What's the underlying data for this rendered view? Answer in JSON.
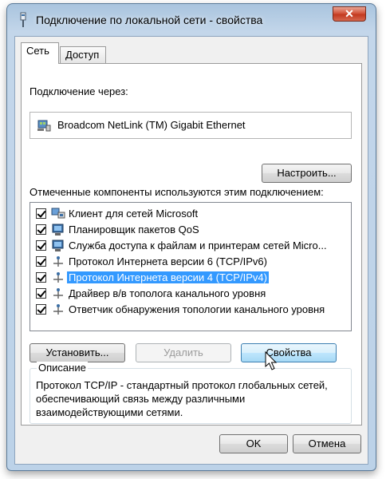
{
  "window": {
    "title": "Подключение по локальной сети - свойства",
    "close_glyph": "✕"
  },
  "tabs": [
    {
      "label": "Сеть",
      "active": true
    },
    {
      "label": "Доступ",
      "active": false
    }
  ],
  "connection": {
    "label": "Подключение через:",
    "adapter": "Broadcom NetLink (TM) Gigabit Ethernet",
    "adapter_icon": "network-adapter-icon",
    "configure_button": "Настроить..."
  },
  "components": {
    "label": "Отмеченные компоненты используются этим подключением:",
    "items": [
      {
        "label": "Клиент для сетей Microsoft",
        "checked": true,
        "icon": "network-client-icon",
        "selected": false
      },
      {
        "label": "Планировщик пакетов QoS",
        "checked": true,
        "icon": "network-service-icon",
        "selected": false
      },
      {
        "label": "Служба доступа к файлам и принтерам сетей Micro...",
        "checked": true,
        "icon": "network-service-icon",
        "selected": false
      },
      {
        "label": "Протокол Интернета версии 6 (TCP/IPv6)",
        "checked": true,
        "icon": "protocol-icon",
        "selected": false
      },
      {
        "label": "Протокол Интернета версии 4 (TCP/IPv4)",
        "checked": true,
        "icon": "protocol-icon",
        "selected": true
      },
      {
        "label": "Драйвер в/в тополога канального уровня",
        "checked": true,
        "icon": "protocol-icon",
        "selected": false
      },
      {
        "label": "Ответчик обнаружения топологии канального уровня",
        "checked": true,
        "icon": "protocol-icon",
        "selected": false
      }
    ]
  },
  "actions": {
    "install": "Установить...",
    "remove": "Удалить",
    "properties": "Свойства"
  },
  "description": {
    "title": "Описание",
    "text": "Протокол TCP/IP - стандартный протокол глобальных сетей, обеспечивающий связь между различными взаимодействующими сетями."
  },
  "footer": {
    "ok": "OK",
    "cancel": "Отмена"
  },
  "colors": {
    "selection": "#3399ff",
    "close_button": "#c2391f",
    "frame": "#bcd2e8"
  }
}
